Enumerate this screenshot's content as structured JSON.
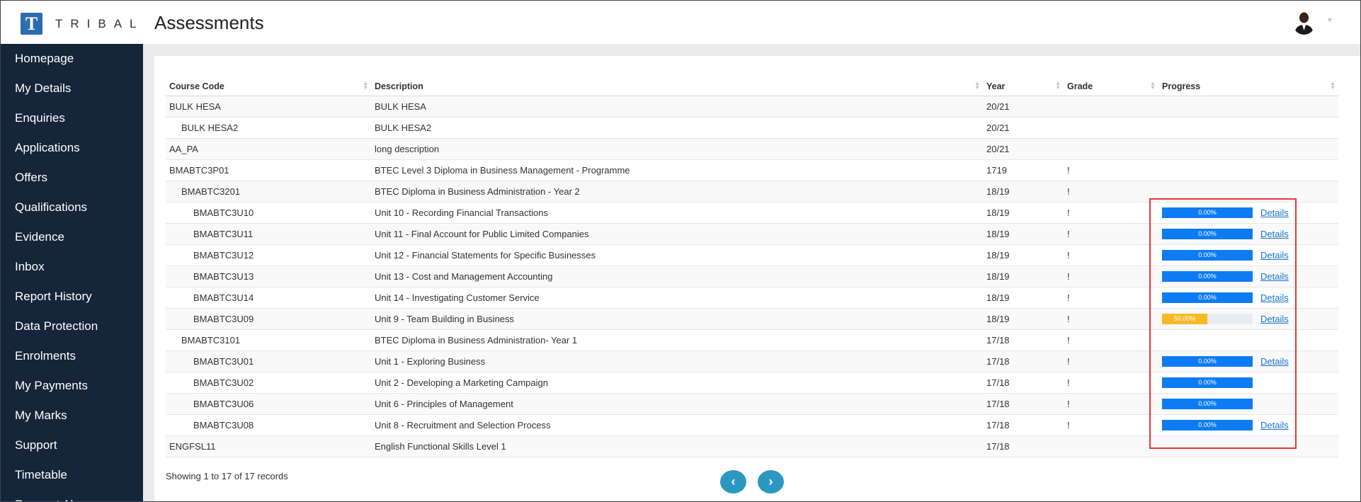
{
  "logo": {
    "letter": "T",
    "text": "TRIBAL"
  },
  "header": {
    "title": "Assessments",
    "caret": "▾"
  },
  "sidebar": {
    "items": [
      {
        "label": "Homepage"
      },
      {
        "label": "My Details"
      },
      {
        "label": "Enquiries"
      },
      {
        "label": "Applications"
      },
      {
        "label": "Offers"
      },
      {
        "label": "Qualifications"
      },
      {
        "label": "Evidence"
      },
      {
        "label": "Inbox"
      },
      {
        "label": "Report History"
      },
      {
        "label": "Data Protection"
      },
      {
        "label": "Enrolments"
      },
      {
        "label": "My Payments"
      },
      {
        "label": "My Marks"
      },
      {
        "label": "Support"
      },
      {
        "label": "Timetable"
      },
      {
        "label": "Request Absence"
      }
    ]
  },
  "table": {
    "headers": {
      "course_code": "Course Code",
      "description": "Description",
      "year": "Year",
      "grade": "Grade",
      "progress": "Progress"
    },
    "rows": [
      {
        "code": "BULK HESA",
        "description": "BULK HESA",
        "year": "20/21",
        "grade": "",
        "progress": null,
        "details": ""
      },
      {
        "code": "BULK HESA2",
        "description": "BULK HESA2",
        "year": "20/21",
        "grade": "",
        "progress": null,
        "details": ""
      },
      {
        "code": "AA_PA",
        "description": "long description",
        "year": "20/21",
        "grade": "",
        "progress": null,
        "details": ""
      },
      {
        "code": "BMABTC3P01",
        "description": "BTEC Level 3 Diploma in Business Management - Programme",
        "year": "1719",
        "grade": "!",
        "progress": null,
        "details": ""
      },
      {
        "code": "BMABTC3201",
        "description": "BTEC Diploma in Business Administration - Year 2",
        "year": "18/19",
        "grade": "!",
        "progress": null,
        "details": ""
      },
      {
        "code": "BMABTC3U10",
        "description": "Unit 10 - Recording Financial Transactions",
        "year": "18/19",
        "grade": "!",
        "progress": "0.00%",
        "details": "Details"
      },
      {
        "code": "BMABTC3U11",
        "description": "Unit 11 - Final Account for Public Limited Companies",
        "year": "18/19",
        "grade": "!",
        "progress": "0.00%",
        "details": "Details"
      },
      {
        "code": "BMABTC3U12",
        "description": "Unit 12 - Financial Statements for Specific Businesses",
        "year": "18/19",
        "grade": "!",
        "progress": "0.00%",
        "details": "Details"
      },
      {
        "code": "BMABTC3U13",
        "description": "Unit 13 - Cost and Management Accounting",
        "year": "18/19",
        "grade": "!",
        "progress": "0.00%",
        "details": "Details"
      },
      {
        "code": "BMABTC3U14",
        "description": "Unit 14 - Investigating Customer Service",
        "year": "18/19",
        "grade": "!",
        "progress": "0.00%",
        "details": "Details"
      },
      {
        "code": "BMABTC3U09",
        "description": "Unit 9 - Team Building in Business",
        "year": "18/19",
        "grade": "!",
        "progress": "50.00%",
        "details": "Details"
      },
      {
        "code": "BMABTC3101",
        "description": "BTEC Diploma in Business Administration- Year 1",
        "year": "17/18",
        "grade": "!",
        "progress": null,
        "details": ""
      },
      {
        "code": "BMABTC3U01",
        "description": "Unit 1 - Exploring Business",
        "year": "17/18",
        "grade": "!",
        "progress": "0.00%",
        "details": "Details"
      },
      {
        "code": "BMABTC3U02",
        "description": "Unit 2 - Developing a Marketing Campaign",
        "year": "17/18",
        "grade": "!",
        "progress": "0.00%",
        "details": ""
      },
      {
        "code": "BMABTC3U06",
        "description": "Unit 6 - Principles of Management",
        "year": "17/18",
        "grade": "!",
        "progress": "0.00%",
        "details": ""
      },
      {
        "code": "BMABTC3U08",
        "description": "Unit 8 - Recruitment and Selection Process",
        "year": "17/18",
        "grade": "!",
        "progress": "0.00%",
        "details": "Details"
      },
      {
        "code": "ENGFSL11",
        "description": "English Functional Skills Level 1",
        "year": "17/18",
        "grade": "",
        "progress": null,
        "details": ""
      }
    ],
    "row_levels": [
      0,
      1,
      0,
      0,
      1,
      2,
      2,
      2,
      2,
      2,
      2,
      1,
      2,
      2,
      2,
      2,
      0
    ]
  },
  "footer": {
    "info": "Showing 1 to 17 of 17 records",
    "prev_icon": "‹",
    "next_icon": "›"
  },
  "colors": {
    "sidebar_bg": "#15253a",
    "progress_blue": "#0d7cf2",
    "progress_yellow": "#f7b924",
    "link": "#1a73c9",
    "highlight": "#e53935",
    "pager": "#2c98c2"
  },
  "icons": {
    "sort": "sort-icon",
    "avatar": "user-avatar",
    "prev": "chevron-left-icon",
    "next": "chevron-right-icon"
  }
}
